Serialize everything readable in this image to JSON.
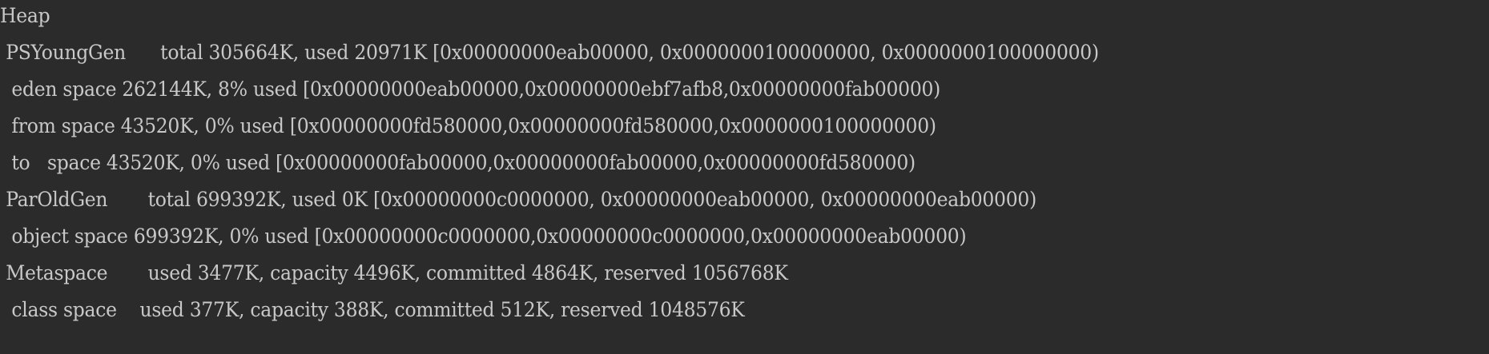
{
  "console": {
    "lines": [
      "Heap",
      " PSYoungGen      total 305664K, used 20971K [0x00000000eab00000, 0x0000000100000000, 0x0000000100000000)",
      "  eden space 262144K, 8% used [0x00000000eab00000,0x00000000ebf7afb8,0x00000000fab00000)",
      "  from space 43520K, 0% used [0x00000000fd580000,0x00000000fd580000,0x0000000100000000)",
      "  to   space 43520K, 0% used [0x00000000fab00000,0x00000000fab00000,0x00000000fd580000)",
      " ParOldGen       total 699392K, used 0K [0x00000000c0000000, 0x00000000eab00000, 0x00000000eab00000)",
      "  object space 699392K, 0% used [0x00000000c0000000,0x00000000c0000000,0x00000000eab00000)",
      " Metaspace       used 3477K, capacity 4496K, committed 4864K, reserved 1056768K",
      "  class space    used 377K, capacity 388K, committed 512K, reserved 1048576K"
    ]
  }
}
